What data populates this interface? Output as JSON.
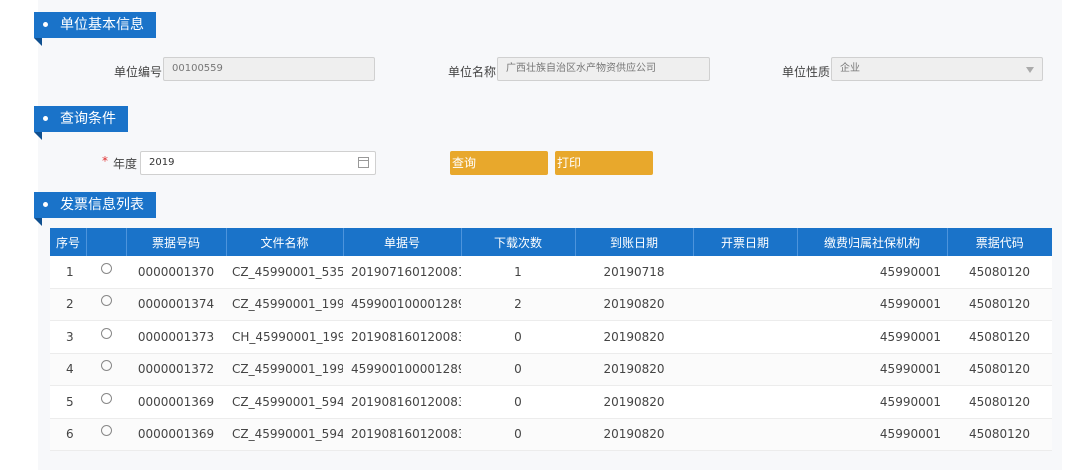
{
  "sections": {
    "basic_info": "单位基本信息",
    "query": "查询条件",
    "invoice_list": "发票信息列表"
  },
  "unit": {
    "code_label": "单位编号",
    "code_value": "00100559",
    "name_label": "单位名称",
    "name_value": "广西壮族自治区水产物资供应公司",
    "type_label": "单位性质",
    "type_value": "企业"
  },
  "query": {
    "required_mark": "*",
    "year_label": "年度",
    "year_value": "2019",
    "search_label": "查询",
    "print_label": "打印"
  },
  "table": {
    "headers": [
      "序号",
      "",
      "票据号码",
      "文件名称",
      "单据号",
      "下载次数",
      "到账日期",
      "开票日期",
      "缴费归属社保机构",
      "票据代码"
    ],
    "rows": [
      {
        "seq": "1",
        "invoice_no": "0000001370",
        "file": "CZ_45990001_535...",
        "doc_no": "201907160120081...",
        "downloads": "1",
        "arrival": "20190718",
        "issue": "",
        "agency": "45990001",
        "code": "45080120"
      },
      {
        "seq": "2",
        "invoice_no": "0000001374",
        "file": "CZ_45990001_199...",
        "doc_no": "459900100001289...",
        "downloads": "2",
        "arrival": "20190820",
        "issue": "",
        "agency": "45990001",
        "code": "45080120"
      },
      {
        "seq": "3",
        "invoice_no": "0000001373",
        "file": "CH_45990001_199...",
        "doc_no": "201908160120083...",
        "downloads": "0",
        "arrival": "20190820",
        "issue": "",
        "agency": "45990001",
        "code": "45080120"
      },
      {
        "seq": "4",
        "invoice_no": "0000001372",
        "file": "CZ_45990001_199...",
        "doc_no": "459900100001289...",
        "downloads": "0",
        "arrival": "20190820",
        "issue": "",
        "agency": "45990001",
        "code": "45080120"
      },
      {
        "seq": "5",
        "invoice_no": "0000001369",
        "file": "CZ_45990001_594...",
        "doc_no": "201908160120083...",
        "downloads": "0",
        "arrival": "20190820",
        "issue": "",
        "agency": "45990001",
        "code": "45080120"
      },
      {
        "seq": "6",
        "invoice_no": "0000001369",
        "file": "CZ_45990001_594...",
        "doc_no": "201908160120083...",
        "downloads": "0",
        "arrival": "20190820",
        "issue": "",
        "agency": "45990001",
        "code": "45080120"
      }
    ]
  },
  "colors": {
    "header_blue": "#1a73c9",
    "button_orange": "#e8a82c",
    "required_red": "#e03030"
  }
}
